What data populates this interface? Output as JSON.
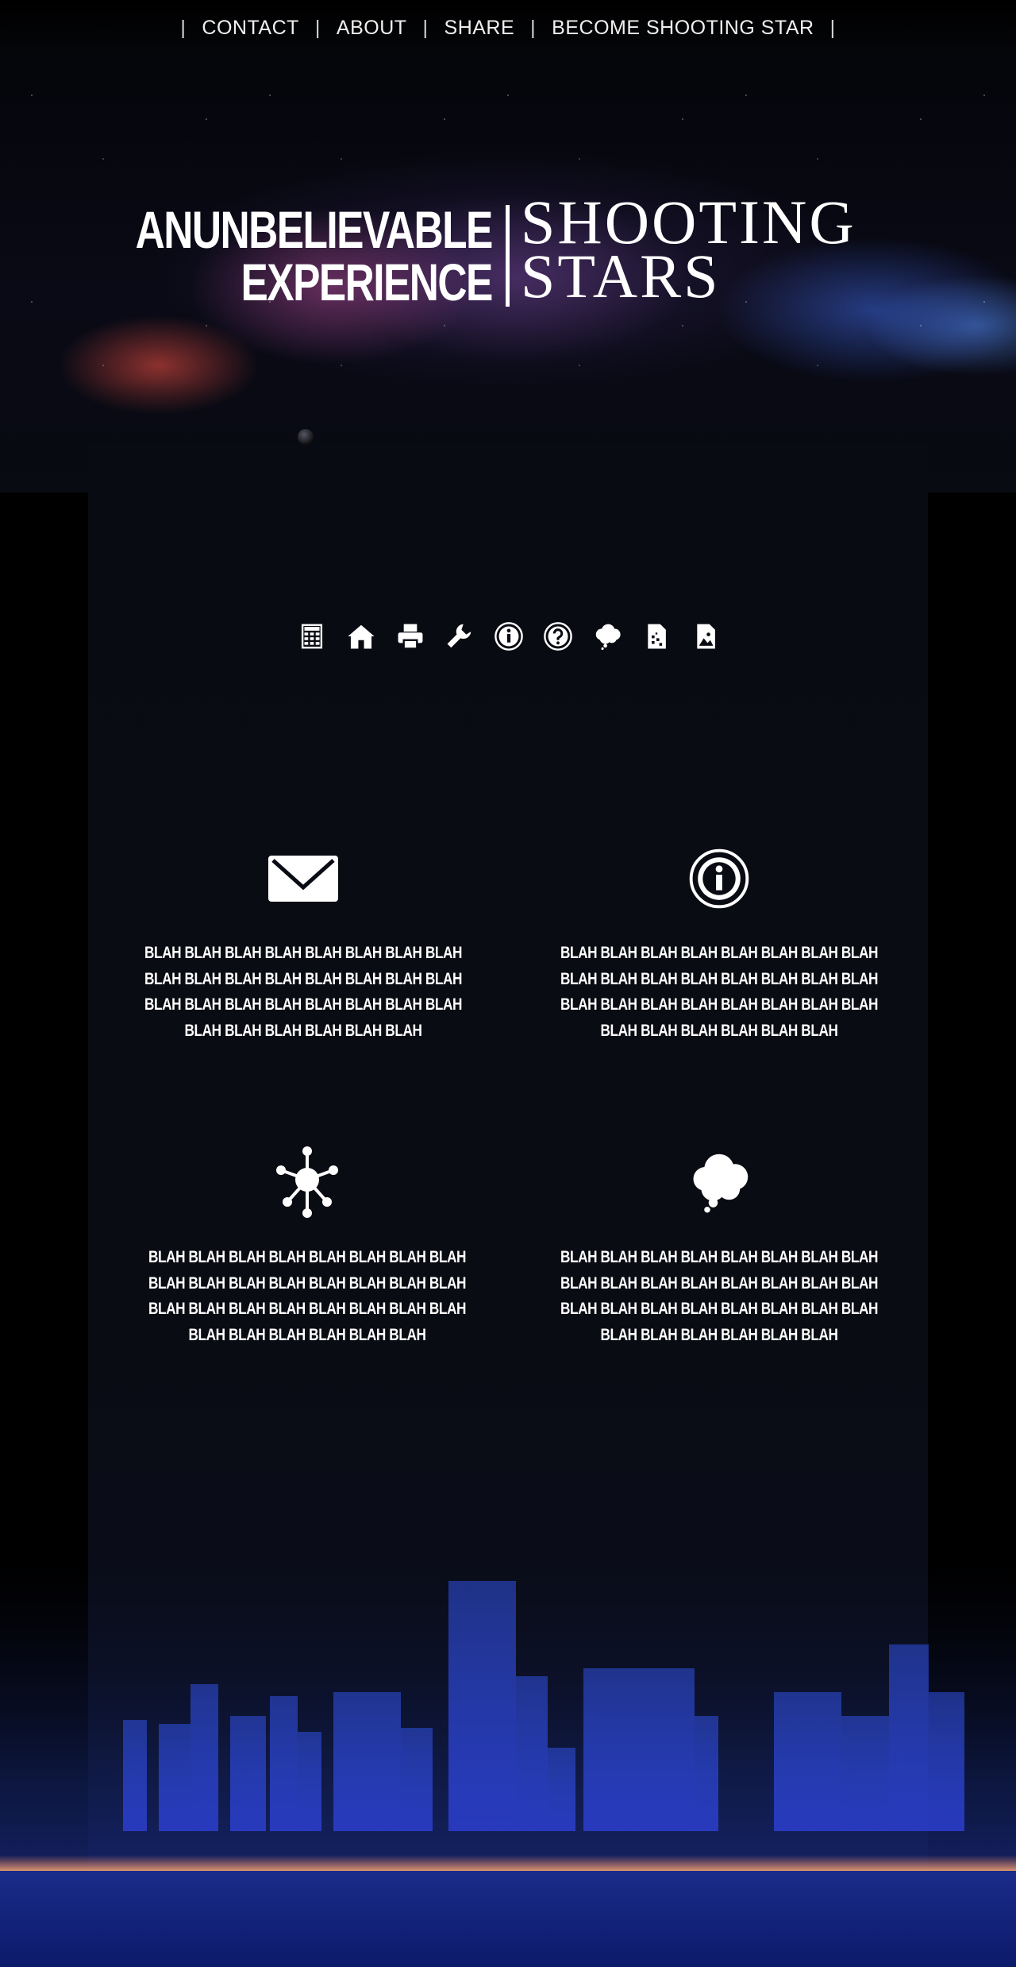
{
  "nav": {
    "separator": "|",
    "links": [
      "CONTACT",
      "ABOUT",
      "SHARE",
      "BECOME SHOOTING STAR"
    ]
  },
  "hero": {
    "title_left_line1": "ANUNBELIEVABLE",
    "title_left_line2": "EXPERIENCE",
    "title_right_line1": "SHOOTING",
    "title_right_line2": "STARS"
  },
  "toolbar_icons": [
    "calculator-icon",
    "home-icon",
    "printer-icon",
    "wrench-icon",
    "info-icon",
    "help-icon",
    "cloud-icon",
    "file-code-icon",
    "file-image-icon"
  ],
  "features": [
    {
      "icon": "envelope-icon",
      "text": "BLAH BLAH BLAH BLAH BLAH BLAH BLAH BLAH BLAH BLAH BLAH BLAH BLAH BLAH BLAH BLAH BLAH BLAH BLAH BLAH BLAH BLAH BLAH BLAH BLAH BLAH BLAH BLAH BLAH BLAH"
    },
    {
      "icon": "info-icon",
      "text": "BLAH BLAH BLAH BLAH BLAH BLAH BLAH BLAH BLAH BLAH BLAH BLAH BLAH BLAH BLAH BLAH BLAH BLAH BLAH BLAH BLAH BLAH BLAH BLAH BLAH BLAH BLAH BLAH BLAH BLAH"
    },
    {
      "icon": "network-icon",
      "text": "BLAH BLAH BLAH BLAH BLAH BLAH BLAH BLAH BLAH BLAH BLAH BLAH BLAH BLAH BLAH BLAH BLAH BLAH BLAH BLAH BLAH BLAH BLAH BLAH BLAH BLAH BLAH BLAH BLAH BLAH"
    },
    {
      "icon": "cloud-icon",
      "text": "BLAH BLAH BLAH BLAH BLAH BLAH BLAH BLAH BLAH BLAH BLAH BLAH BLAH BLAH BLAH BLAH BLAH BLAH BLAH BLAH BLAH BLAH BLAH BLAH BLAH BLAH BLAH BLAH BLAH BLAH"
    }
  ],
  "colors": {
    "background": "#000000",
    "panel": "#090b12",
    "text": "#ffffff",
    "city_glow": "#2a48d8",
    "horizon_glow": "#e87a5a"
  }
}
